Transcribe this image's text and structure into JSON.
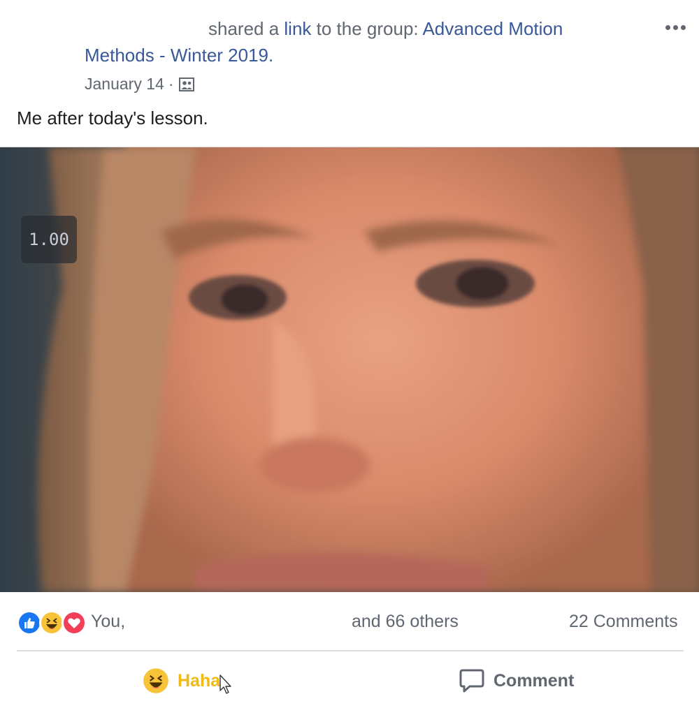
{
  "post": {
    "shared_text": "shared a ",
    "link_text": "link",
    "group_prefix": " to the group: ",
    "group_name_line1": "Advanced Motion",
    "group_name_line2": "Methods - Winter 2019",
    "period": ".",
    "date": "January 14",
    "date_separator": "·",
    "audience_icon": "group-icon",
    "caption": "Me after today's lesson."
  },
  "media": {
    "speed_badge": "1.00"
  },
  "stats": {
    "reaction_icons": [
      "like-icon",
      "haha-icon",
      "love-icon"
    ],
    "reactors_prefix": "You,",
    "reactors_suffix": "and 66 others",
    "comments": "22 Comments"
  },
  "actions": {
    "haha_label": "Haha",
    "comment_label": "Comment"
  },
  "colors": {
    "link_blue": "#385898",
    "haha_yellow": "#f0ba15",
    "secondary_text": "#606770",
    "like_blue": "#1877f2",
    "love_red": "#f33e58"
  }
}
